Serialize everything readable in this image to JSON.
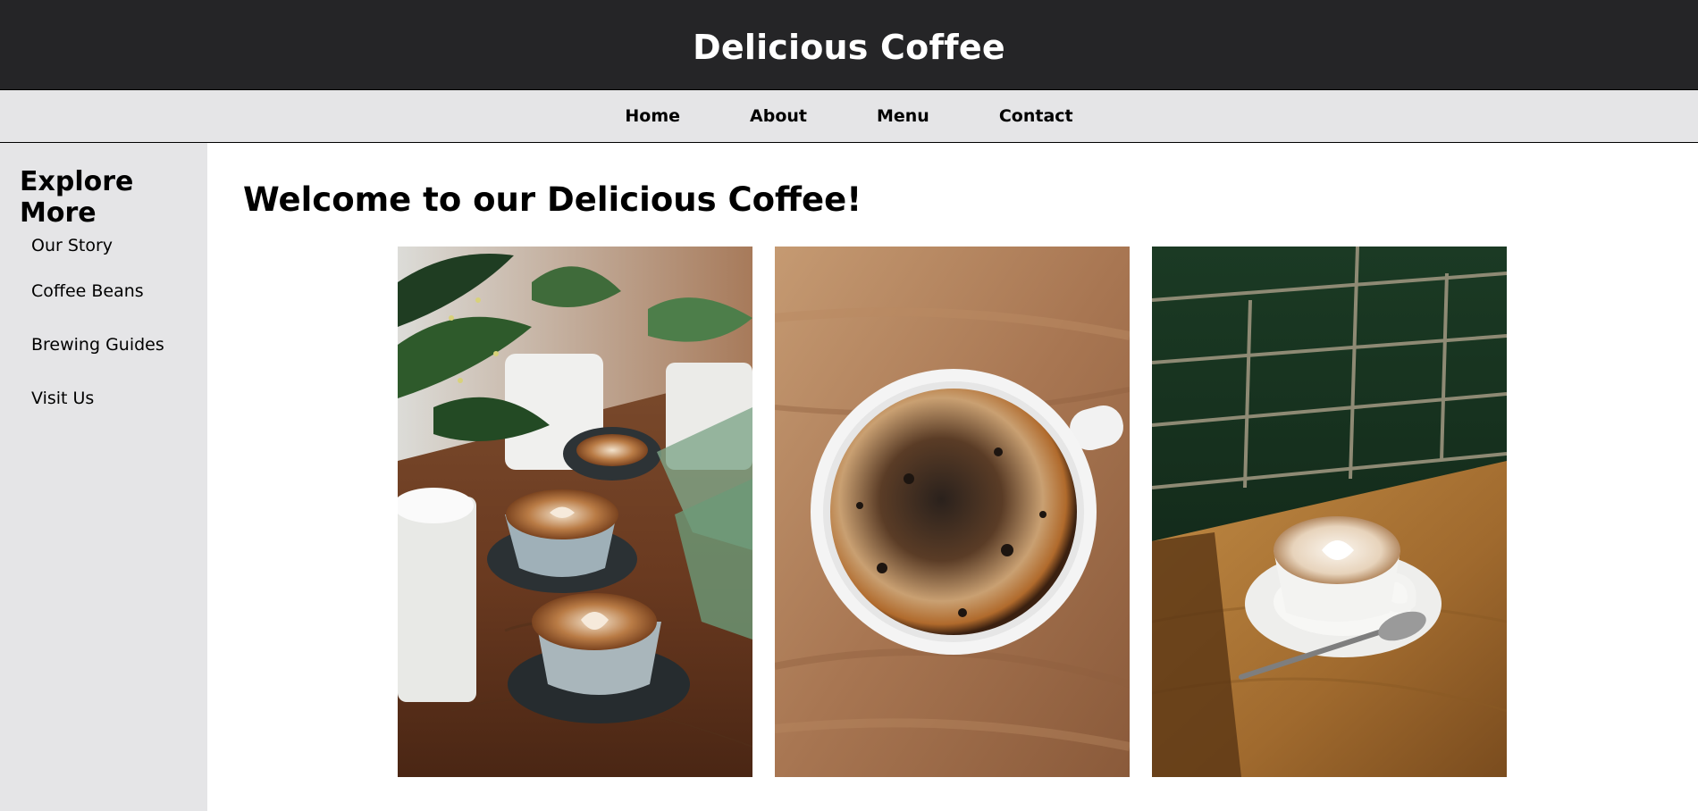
{
  "header": {
    "title": "Delicious Coffee"
  },
  "nav": {
    "items": [
      {
        "label": "Home"
      },
      {
        "label": "About"
      },
      {
        "label": "Menu"
      },
      {
        "label": "Contact"
      }
    ]
  },
  "sidebar": {
    "title": "Explore More",
    "items": [
      {
        "label": "Our Story"
      },
      {
        "label": "Coffee Beans"
      },
      {
        "label": "Brewing Guides"
      },
      {
        "label": "Visit Us"
      }
    ]
  },
  "main": {
    "heading": "Welcome to our Delicious Coffee!",
    "photos": [
      {
        "icon": "latte-art-plants-photo"
      },
      {
        "icon": "black-coffee-cup-photo"
      },
      {
        "icon": "cappuccino-green-tiles-photo"
      }
    ]
  },
  "colors": {
    "header_bg": "#252527",
    "nav_bg": "#e5e5e7",
    "sidebar_bg": "#e5e5e7"
  }
}
